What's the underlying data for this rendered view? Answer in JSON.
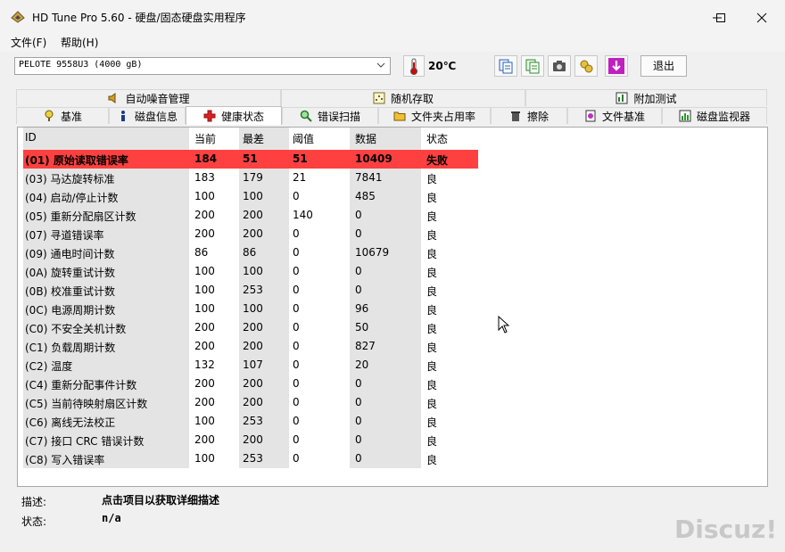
{
  "window": {
    "title": "HD Tune Pro 5.60 - 硬盘/固态硬盘实用程序"
  },
  "menu": [
    "文件(F)",
    "帮助(H)"
  ],
  "toolbar": {
    "drive": "PELOTE  9558U3 (4000 gB)",
    "temperature": "20℃",
    "exit_label": "退出"
  },
  "tabs_top": [
    "自动噪音管理",
    "随机存取",
    "附加测试"
  ],
  "tabs_bottom": [
    "基准",
    "磁盘信息",
    "健康状态",
    "错误扫描",
    "文件夹占用率",
    "擦除",
    "文件基准",
    "磁盘监视器"
  ],
  "active_tab": "健康状态",
  "table": {
    "headers": [
      "ID",
      "当前",
      "最差",
      "阈值",
      "数据",
      "状态"
    ],
    "rows": [
      [
        "(01) 原始读取错误率",
        "184",
        "51",
        "51",
        "10409",
        "失败"
      ],
      [
        "(03) 马达旋转标准",
        "183",
        "179",
        "21",
        "7841",
        "良"
      ],
      [
        "(04) 启动/停止计数",
        "100",
        "100",
        "0",
        "485",
        "良"
      ],
      [
        "(05) 重新分配扇区计数",
        "200",
        "200",
        "140",
        "0",
        "良"
      ],
      [
        "(07) 寻道错误率",
        "200",
        "200",
        "0",
        "0",
        "良"
      ],
      [
        "(09) 通电时间计数",
        "86",
        "86",
        "0",
        "10679",
        "良"
      ],
      [
        "(0A) 旋转重试计数",
        "100",
        "100",
        "0",
        "0",
        "良"
      ],
      [
        "(0B) 校准重试计数",
        "100",
        "253",
        "0",
        "0",
        "良"
      ],
      [
        "(0C) 电源周期计数",
        "100",
        "100",
        "0",
        "96",
        "良"
      ],
      [
        "(C0) 不安全关机计数",
        "200",
        "200",
        "0",
        "50",
        "良"
      ],
      [
        "(C1) 负载周期计数",
        "200",
        "200",
        "0",
        "827",
        "良"
      ],
      [
        "(C2) 温度",
        "132",
        "107",
        "0",
        "20",
        "良"
      ],
      [
        "(C4) 重新分配事件计数",
        "200",
        "200",
        "0",
        "0",
        "良"
      ],
      [
        "(C5) 当前待映射扇区计数",
        "200",
        "200",
        "0",
        "0",
        "良"
      ],
      [
        "(C6) 离线无法校正",
        "100",
        "253",
        "0",
        "0",
        "良"
      ],
      [
        "(C7) 接口 CRC 错误计数",
        "200",
        "200",
        "0",
        "0",
        "良"
      ],
      [
        "(C8) 写入错误率",
        "100",
        "253",
        "0",
        "0",
        "良"
      ]
    ]
  },
  "footer": {
    "desc_label": "描述:",
    "desc_value": "点击项目以获取详细描述",
    "status_label": "状态:",
    "status_value": "n/a"
  },
  "watermark": "Discuz!",
  "colors": {
    "fail_row": "#ff4040",
    "column_shade": "#e4e4e4"
  }
}
